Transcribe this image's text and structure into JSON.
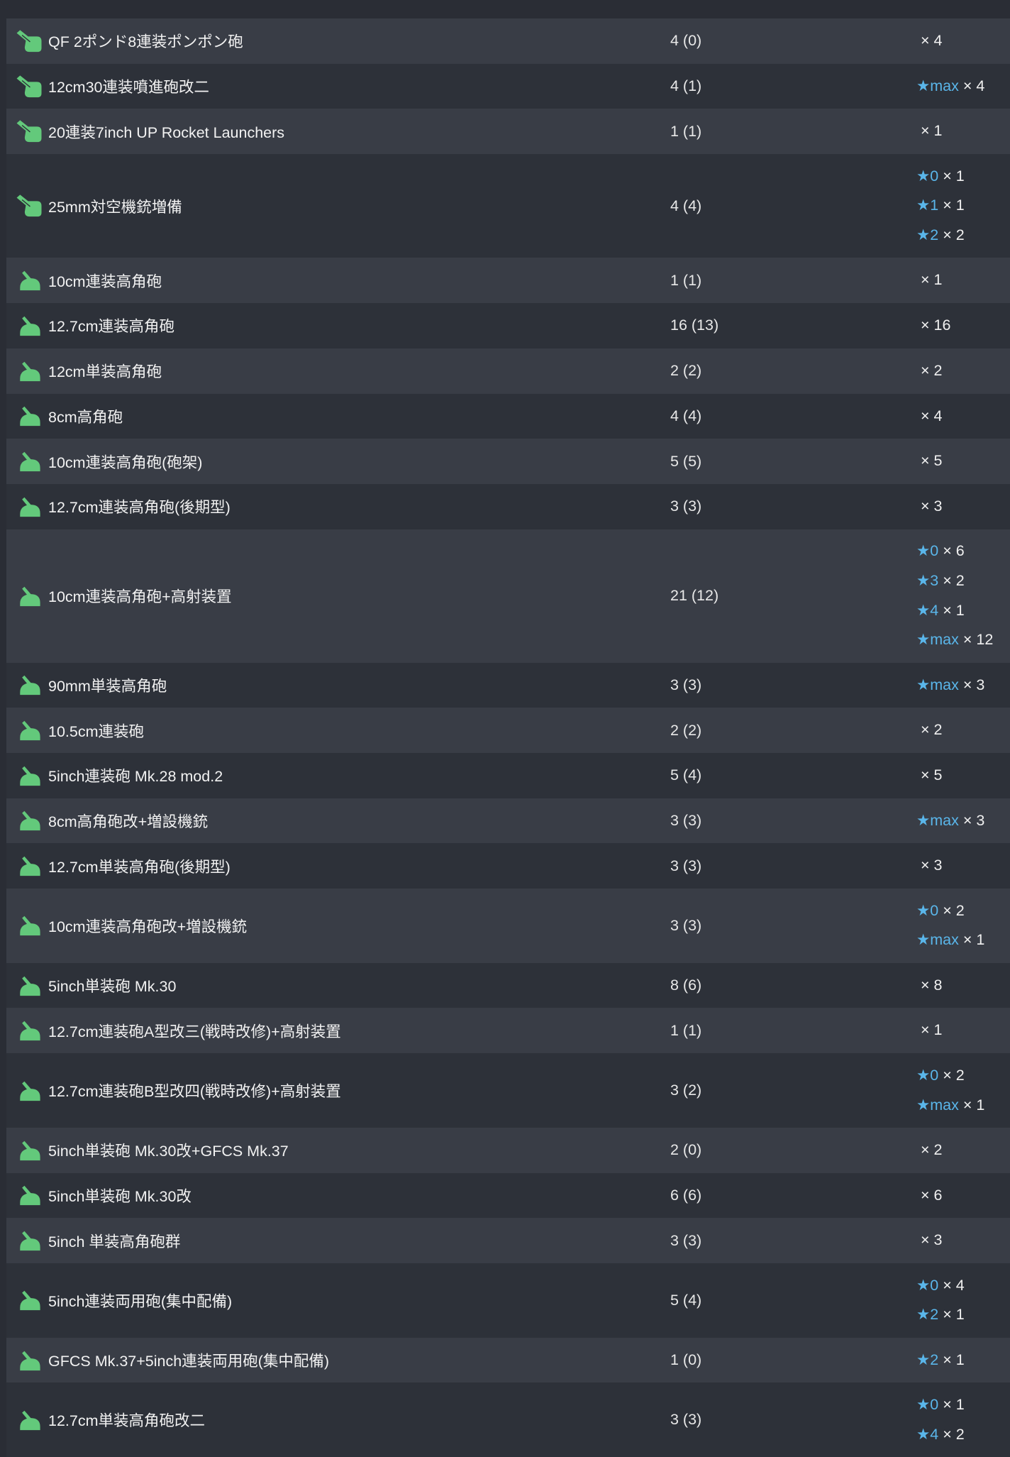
{
  "colors": {
    "page_background": "#2a2d35",
    "row_light": "#393d46",
    "row_dark": "#2d3139",
    "star_level": "#5ab6ea",
    "icon_green": "#63c97b",
    "text": "#eeeeee"
  },
  "rows": [
    {
      "icon": "aa-machine-gun-icon",
      "name": "QF 2ポンド8連装ポンポン砲",
      "count": "4 (0)",
      "stars": [
        {
          "qty": "× 4"
        }
      ]
    },
    {
      "icon": "aa-machine-gun-icon",
      "name": "12cm30連装噴進砲改二",
      "count": "4 (1)",
      "stars": [
        {
          "level": "★max",
          "qty": "× 4"
        }
      ]
    },
    {
      "icon": "aa-machine-gun-icon",
      "name": "20連装7inch UP Rocket Launchers",
      "count": "1 (1)",
      "stars": [
        {
          "qty": "× 1"
        }
      ]
    },
    {
      "icon": "aa-machine-gun-icon",
      "name": "25mm対空機銃増備",
      "count": "4 (4)",
      "stars": [
        {
          "level": "★0",
          "qty": "× 1"
        },
        {
          "level": "★1",
          "qty": "× 1"
        },
        {
          "level": "★2",
          "qty": "× 2"
        }
      ]
    },
    {
      "icon": "high-angle-gun-icon",
      "name": "10cm連装高角砲",
      "count": "1 (1)",
      "stars": [
        {
          "qty": "× 1"
        }
      ]
    },
    {
      "icon": "high-angle-gun-icon",
      "name": "12.7cm連装高角砲",
      "count": "16 (13)",
      "stars": [
        {
          "qty": "× 16"
        }
      ]
    },
    {
      "icon": "high-angle-gun-icon",
      "name": "12cm単装高角砲",
      "count": "2 (2)",
      "stars": [
        {
          "qty": "× 2"
        }
      ]
    },
    {
      "icon": "high-angle-gun-icon",
      "name": "8cm高角砲",
      "count": "4 (4)",
      "stars": [
        {
          "qty": "× 4"
        }
      ]
    },
    {
      "icon": "high-angle-gun-icon",
      "name": "10cm連装高角砲(砲架)",
      "count": "5 (5)",
      "stars": [
        {
          "qty": "× 5"
        }
      ]
    },
    {
      "icon": "high-angle-gun-icon",
      "name": "12.7cm連装高角砲(後期型)",
      "count": "3 (3)",
      "stars": [
        {
          "qty": "× 3"
        }
      ]
    },
    {
      "icon": "high-angle-gun-icon",
      "name": "10cm連装高角砲+高射装置",
      "count": "21 (12)",
      "stars": [
        {
          "level": "★0",
          "qty": "× 6"
        },
        {
          "level": "★3",
          "qty": "× 2"
        },
        {
          "level": "★4",
          "qty": "× 1"
        },
        {
          "level": "★max",
          "qty": "× 12"
        }
      ]
    },
    {
      "icon": "high-angle-gun-icon",
      "name": "90mm単装高角砲",
      "count": "3 (3)",
      "stars": [
        {
          "level": "★max",
          "qty": "× 3"
        }
      ]
    },
    {
      "icon": "high-angle-gun-icon",
      "name": "10.5cm連装砲",
      "count": "2 (2)",
      "stars": [
        {
          "qty": "× 2"
        }
      ]
    },
    {
      "icon": "high-angle-gun-icon",
      "name": "5inch連装砲 Mk.28 mod.2",
      "count": "5 (4)",
      "stars": [
        {
          "qty": "× 5"
        }
      ]
    },
    {
      "icon": "high-angle-gun-icon",
      "name": "8cm高角砲改+増設機銃",
      "count": "3 (3)",
      "stars": [
        {
          "level": "★max",
          "qty": "× 3"
        }
      ]
    },
    {
      "icon": "high-angle-gun-icon",
      "name": "12.7cm単装高角砲(後期型)",
      "count": "3 (3)",
      "stars": [
        {
          "qty": "× 3"
        }
      ]
    },
    {
      "icon": "high-angle-gun-icon",
      "name": "10cm連装高角砲改+増設機銃",
      "count": "3 (3)",
      "stars": [
        {
          "level": "★0",
          "qty": "× 2"
        },
        {
          "level": "★max",
          "qty": "× 1"
        }
      ]
    },
    {
      "icon": "high-angle-gun-icon",
      "name": "5inch単装砲 Mk.30",
      "count": "8 (6)",
      "stars": [
        {
          "qty": "× 8"
        }
      ]
    },
    {
      "icon": "high-angle-gun-icon",
      "name": "12.7cm連装砲A型改三(戦時改修)+高射装置",
      "count": "1 (1)",
      "stars": [
        {
          "qty": "× 1"
        }
      ]
    },
    {
      "icon": "high-angle-gun-icon",
      "name": "12.7cm連装砲B型改四(戦時改修)+高射装置",
      "count": "3 (2)",
      "stars": [
        {
          "level": "★0",
          "qty": "× 2"
        },
        {
          "level": "★max",
          "qty": "× 1"
        }
      ]
    },
    {
      "icon": "high-angle-gun-icon",
      "name": "5inch単装砲 Mk.30改+GFCS Mk.37",
      "count": "2 (0)",
      "stars": [
        {
          "qty": "× 2"
        }
      ]
    },
    {
      "icon": "high-angle-gun-icon",
      "name": "5inch単装砲 Mk.30改",
      "count": "6 (6)",
      "stars": [
        {
          "qty": "× 6"
        }
      ]
    },
    {
      "icon": "high-angle-gun-icon",
      "name": "5inch 単装高角砲群",
      "count": "3 (3)",
      "stars": [
        {
          "qty": "× 3"
        }
      ]
    },
    {
      "icon": "high-angle-gun-icon",
      "name": "5inch連装両用砲(集中配備)",
      "count": "5 (4)",
      "stars": [
        {
          "level": "★0",
          "qty": "× 4"
        },
        {
          "level": "★2",
          "qty": "× 1"
        }
      ]
    },
    {
      "icon": "high-angle-gun-icon",
      "name": "GFCS Mk.37+5inch連装両用砲(集中配備)",
      "count": "1 (0)",
      "stars": [
        {
          "level": "★2",
          "qty": "× 1"
        }
      ]
    },
    {
      "icon": "high-angle-gun-icon",
      "name": "12.7cm単装高角砲改二",
      "count": "3 (3)",
      "stars": [
        {
          "level": "★0",
          "qty": "× 1"
        },
        {
          "level": "★4",
          "qty": "× 2"
        }
      ]
    }
  ]
}
